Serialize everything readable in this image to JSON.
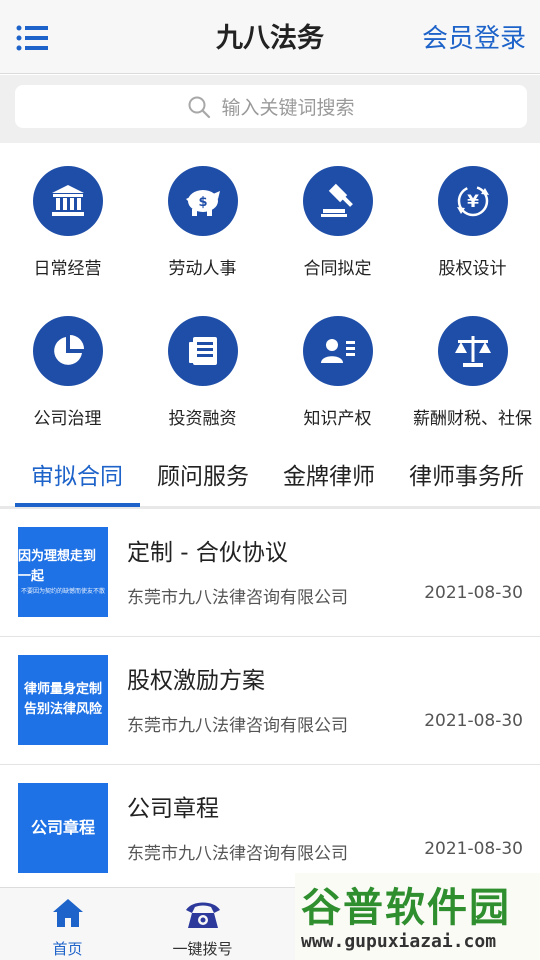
{
  "header": {
    "title": "九八法务",
    "login_label": "会员登录"
  },
  "search": {
    "placeholder": "输入关键词搜索"
  },
  "services": [
    {
      "label": "日常经营",
      "icon": "bank-icon"
    },
    {
      "label": "劳动人事",
      "icon": "piggy-bank-icon"
    },
    {
      "label": "合同拟定",
      "icon": "gavel-icon"
    },
    {
      "label": "股权设计",
      "icon": "yen-exchange-icon"
    },
    {
      "label": "公司治理",
      "icon": "pie-chart-icon"
    },
    {
      "label": "投资融资",
      "icon": "document-icon"
    },
    {
      "label": "知识产权",
      "icon": "id-card-icon"
    },
    {
      "label": "薪酬财税、社保",
      "icon": "scales-icon"
    }
  ],
  "tabs": [
    {
      "label": "审拟合同",
      "active": true
    },
    {
      "label": "顾问服务",
      "active": false
    },
    {
      "label": "金牌律师",
      "active": false
    },
    {
      "label": "律师事务所",
      "active": false
    }
  ],
  "items": [
    {
      "title": "定制 - 合伙协议",
      "org": "东莞市九八法律咨询有限公司",
      "date": "2021-08-30",
      "thumb_line1": "因为理想走到一起",
      "thumb_line2": "不要因为契约的缺憾而使友不散"
    },
    {
      "title": "股权激励方案",
      "org": "东莞市九八法律咨询有限公司",
      "date": "2021-08-30",
      "thumb_line1": "律师量身定制",
      "thumb_line1b": "告别法律风险",
      "thumb_line2": ""
    },
    {
      "title": "公司章程",
      "org": "东莞市九八法律咨询有限公司",
      "date": "2021-08-30",
      "thumb_line1": "公司章程",
      "thumb_line2": ""
    }
  ],
  "bottom_nav": [
    {
      "label": "首页",
      "active": true
    },
    {
      "label": "一键拨号",
      "active": false
    }
  ],
  "watermark": {
    "line1": "谷普软件园",
    "line2": "www.gupuxiazai.com"
  },
  "colors": {
    "accent": "#1e63c9",
    "icon_bg": "#1f4ea8",
    "thumb_bg": "#1f72e6"
  }
}
